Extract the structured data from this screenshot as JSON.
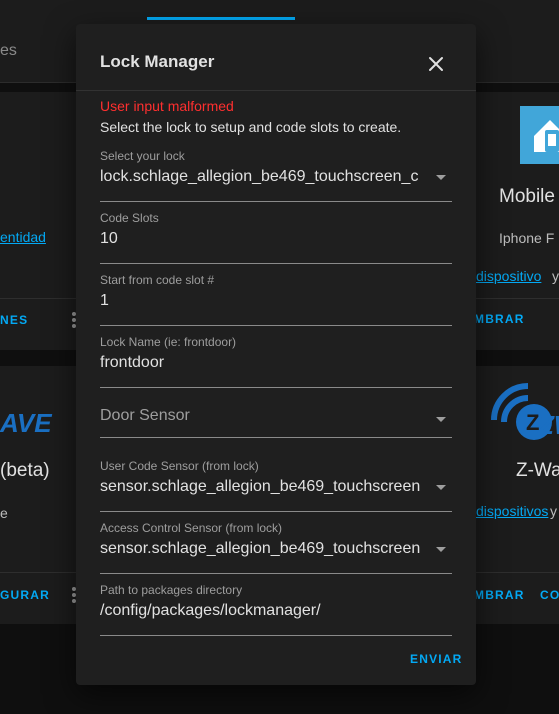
{
  "background": {
    "search_fragment": "es",
    "left_card_1": {
      "link": "entidad",
      "button": "NES"
    },
    "left_card_2": {
      "logo_text": "AVE",
      "title": "(beta)",
      "sub": "e",
      "button": "GURAR"
    },
    "right_card_1": {
      "title": "Mobile",
      "sub": "Iphone F",
      "link": "dispositivo",
      "link_suffix": "y",
      "button": "MBRAR"
    },
    "right_card_2": {
      "logo_text": "ZW",
      "title": "Z-Wa",
      "link": "dispositivos",
      "link_suffix": "y",
      "button_1": "MBRAR",
      "button_2": "CO"
    }
  },
  "dialog": {
    "title": "Lock Manager",
    "error": "User input malformed",
    "description": "Select the lock to setup and code slots to create.",
    "fields": [
      {
        "label": "Select your lock",
        "value": "lock.schlage_allegion_be469_touchscreen_c",
        "type": "select"
      },
      {
        "label": "Code Slots",
        "value": "10",
        "type": "text"
      },
      {
        "label": "Start from code slot #",
        "value": "1",
        "type": "text"
      },
      {
        "label": "Lock Name (ie: frontdoor)",
        "value": "frontdoor",
        "type": "text"
      },
      {
        "label": "Door Sensor",
        "value": "",
        "type": "select"
      },
      {
        "label": "User Code Sensor (from lock)",
        "value": "sensor.schlage_allegion_be469_touchscreen",
        "type": "select"
      },
      {
        "label": "Access Control Sensor (from lock)",
        "value": "sensor.schlage_allegion_be469_touchscreen",
        "type": "select"
      },
      {
        "label": "Path to packages directory",
        "value": "/config/packages/lockmanager/",
        "type": "text"
      }
    ],
    "submit_label": "ENVIAR"
  },
  "colors": {
    "accent": "#03a9f4",
    "error": "#ff2f2f",
    "dialog_bg": "#1f1f1f",
    "page_bg": "#0f0f0f"
  }
}
